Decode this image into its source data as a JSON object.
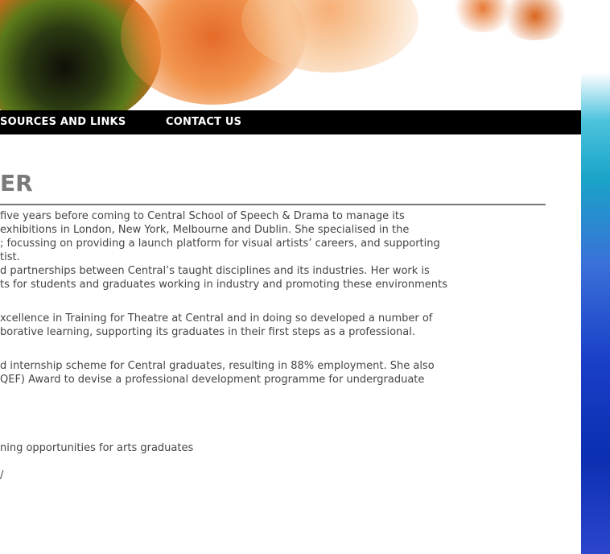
{
  "nav": {
    "items": [
      {
        "label": "SOURCES AND LINKS"
      },
      {
        "label": "CONTACT US"
      }
    ]
  },
  "content": {
    "heading": "ER",
    "paragraphs": [
      [
        " five years before coming to Central School of Speech & Drama to manage its",
        "exhibitions in London, New York, Melbourne and Dublin. She specialised in the",
        "; focussing on providing a launch platform for visual artists’ careers, and supporting",
        "tist."
      ],
      [
        "d partnerships between Central’s taught disciplines and its industries.  Her work is",
        "ts for students and graduates working in industry and promoting these environments"
      ],
      [
        "xcellence in Training for Theatre at Central and in doing so developed a number of",
        "borative learning, supporting its graduates in their first steps as a professional."
      ],
      [
        "d internship scheme for Central graduates, resulting in 88% employment.  She also",
        "QEF) Award to devise a professional development programme for undergraduate"
      ],
      [
        "ning opportunities for arts graduates"
      ],
      [
        "/"
      ]
    ]
  },
  "colors": {
    "navbar_bg": "#000000",
    "nav_text": "#ffffff",
    "heading": "#7a7a7a",
    "body_text": "#444444"
  }
}
